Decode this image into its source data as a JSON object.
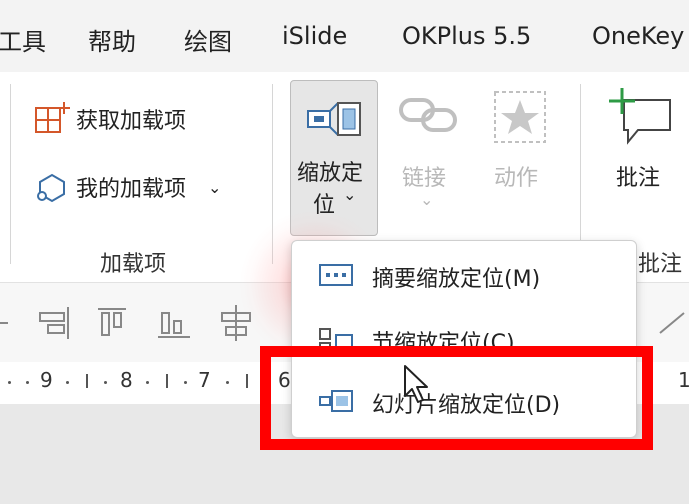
{
  "tabs": [
    "工具",
    "帮助",
    "绘图",
    "iSlide",
    "OKPlus 5.5",
    "OneKey"
  ],
  "addins_group": {
    "get_addins": "获取加载项",
    "my_addins": "我的加载项",
    "label": "加载项"
  },
  "zoom_group": {
    "zoom_label_line1": "缩放定",
    "zoom_label_line2": "位",
    "link_label": "链接",
    "action_label": "动作"
  },
  "comments_group": {
    "comment_label": "批注",
    "label": "批注"
  },
  "dropdown": {
    "items": [
      "摘要缩放定位(M)",
      "节缩放定位(C)",
      "幻灯片缩放定位(D)"
    ]
  },
  "ruler": {
    "numbers": [
      "9",
      "8",
      "7",
      "6",
      "1"
    ]
  },
  "colors": {
    "highlight": "#ff0000",
    "icon_blue": "#3a6ea5",
    "icon_orange": "#d4572a",
    "icon_green": "#2e9b45"
  }
}
